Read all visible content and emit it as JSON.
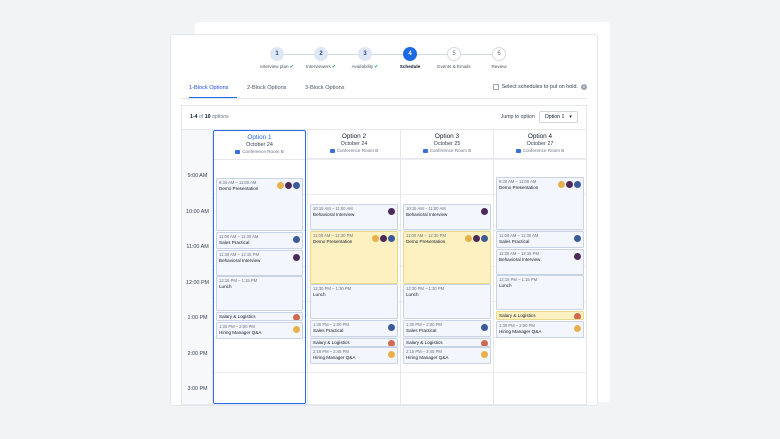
{
  "stepper": {
    "steps": [
      {
        "num": "1",
        "label": "Interview plan",
        "state": "done"
      },
      {
        "num": "2",
        "label": "Interviewers",
        "state": "done"
      },
      {
        "num": "3",
        "label": "Availability",
        "state": "done"
      },
      {
        "num": "4",
        "label": "Schedule",
        "state": "active"
      },
      {
        "num": "5",
        "label": "Events & Emails",
        "state": "pending"
      },
      {
        "num": "6",
        "label": "Review",
        "state": "pending"
      }
    ],
    "check_glyph": "✔"
  },
  "tabs": [
    {
      "label": "1-Block Options"
    },
    {
      "label": "2-Block Options"
    },
    {
      "label": "3-Block Options"
    }
  ],
  "hold": {
    "label": "Select schedules to put on hold.",
    "info": "i"
  },
  "results": {
    "range": "1-4",
    "of": "of",
    "total": "10",
    "suffix": "options"
  },
  "jump": {
    "label": "Jump to option",
    "selected": "Option 1",
    "caret": "▾"
  },
  "times": [
    "9:00 AM",
    "10:00 AM",
    "11:00 AM",
    "12:00 PM",
    "1:00 PM",
    "2:00 PM",
    "3:00 PM"
  ],
  "options": [
    {
      "name": "Option 1",
      "date": "October 24",
      "room": "Conference Room B",
      "events": [
        {
          "time": "9:30 AM – 11:00 AM",
          "title": "Demo Presentation",
          "avatars": [
            "a",
            "b",
            "c"
          ]
        },
        {
          "time": "11:00 AM – 11:30 AM",
          "title": "Sales Practical",
          "avatars": [
            "c"
          ]
        },
        {
          "time": "11:30 AM – 12:15 PM",
          "title": "Behavioral Interview",
          "avatars": [
            "b"
          ]
        },
        {
          "time": "12:15 PM – 1:15 PM",
          "title": "Lunch",
          "avatars": []
        },
        {
          "time": "",
          "title": "Salary & Logistics",
          "avatars": [
            "d"
          ]
        },
        {
          "time": "1:30 PM – 2:00 PM",
          "title": "Hiring Manager Q&A",
          "avatars": [
            "a"
          ]
        }
      ]
    },
    {
      "name": "Option 2",
      "date": "October 24",
      "room": "Conference Room B",
      "events": [
        {
          "time": "10:15 AM – 11:00 AM",
          "title": "Behavioral Interview",
          "avatars": [
            "b"
          ]
        },
        {
          "time": "11:00 AM – 12:30 PM",
          "title": "Demo Presentation",
          "avatars": [
            "a",
            "b",
            "c"
          ]
        },
        {
          "time": "12:30 PM – 1:30 PM",
          "title": "Lunch",
          "avatars": []
        },
        {
          "time": "1:30 PM – 2:00 PM",
          "title": "Sales Practical",
          "avatars": [
            "c"
          ]
        },
        {
          "time": "",
          "title": "Salary & Logistics",
          "avatars": [
            "d"
          ]
        },
        {
          "time": "2:15 PM – 2:45 PM",
          "title": "Hiring Manager Q&A",
          "avatars": [
            "a"
          ]
        }
      ]
    },
    {
      "name": "Option 3",
      "date": "October 25",
      "room": "Conference Room B",
      "events": [
        {
          "time": "10:15 AM – 11:00 AM",
          "title": "Behavioral Interview",
          "avatars": [
            "b"
          ]
        },
        {
          "time": "11:00 AM – 12:30 PM",
          "title": "Demo Presentation",
          "avatars": [
            "a",
            "b",
            "c"
          ]
        },
        {
          "time": "12:30 PM – 1:30 PM",
          "title": "Lunch",
          "avatars": []
        },
        {
          "time": "1:30 PM – 2:00 PM",
          "title": "Sales Practical",
          "avatars": [
            "c"
          ]
        },
        {
          "time": "",
          "title": "Salary & Logistics",
          "avatars": [
            "d"
          ]
        },
        {
          "time": "2:15 PM – 2:45 PM",
          "title": "Hiring Manager Q&A",
          "avatars": [
            "a"
          ]
        }
      ]
    },
    {
      "name": "Option 4",
      "date": "October 27",
      "room": "Conference Room B",
      "events": [
        {
          "time": "9:30 AM – 11:00 AM",
          "title": "Demo Presentation",
          "avatars": [
            "a",
            "b",
            "c"
          ]
        },
        {
          "time": "11:00 AM – 11:30 AM",
          "title": "Sales Practical",
          "avatars": [
            "c"
          ]
        },
        {
          "time": "11:30 AM – 12:15 PM",
          "title": "Behavioral Interview",
          "avatars": [
            "b"
          ]
        },
        {
          "time": "12:15 PM – 1:15 PM",
          "title": "Lunch",
          "avatars": []
        },
        {
          "time": "",
          "title": "Salary & Logistics",
          "avatars": [
            "d"
          ]
        },
        {
          "time": "1:30 PM – 2:00 PM",
          "title": "Hiring Manager Q&A",
          "avatars": [
            "a"
          ]
        }
      ]
    }
  ]
}
